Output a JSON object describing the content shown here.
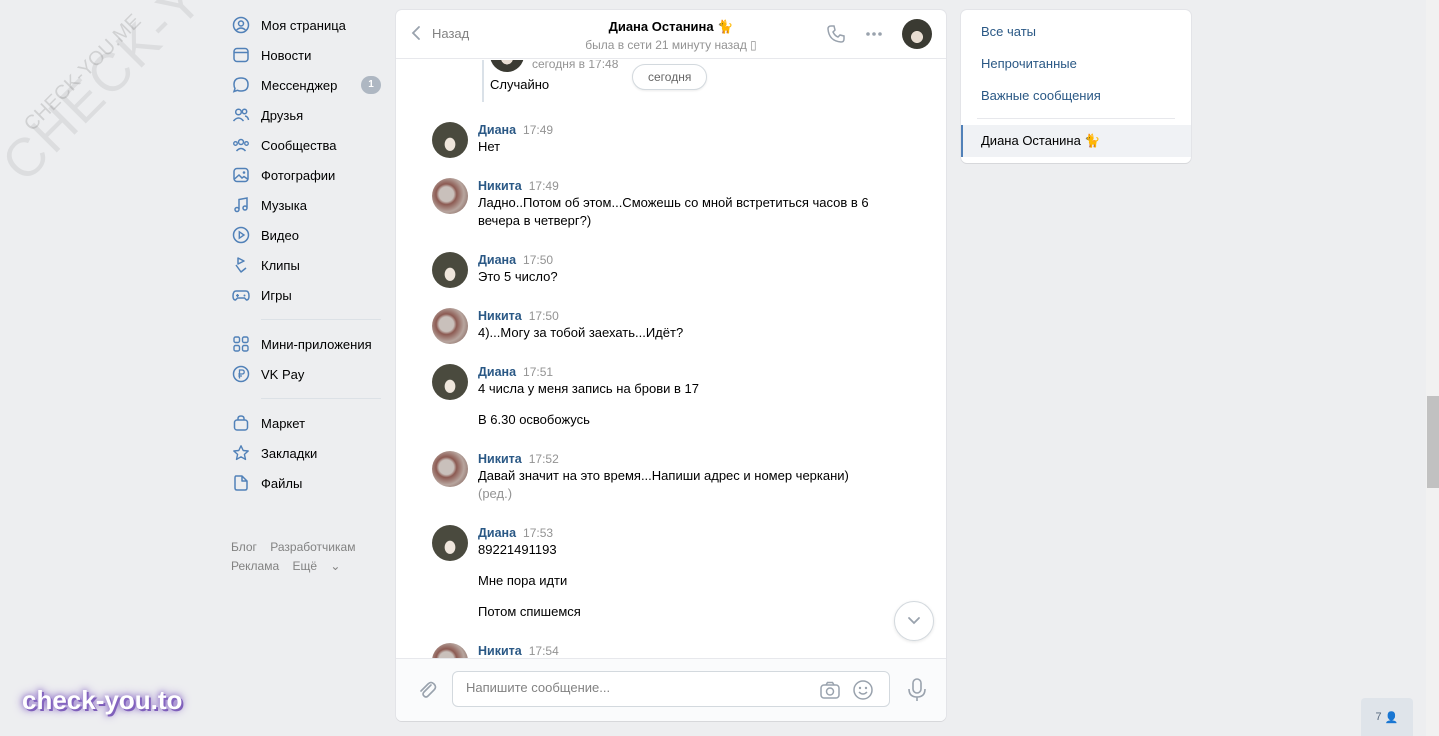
{
  "watermark": {
    "big": "CHECK-YOU.ME",
    "small": "CHECK-YOU.ME",
    "brand": "check-you.to"
  },
  "nav": {
    "items": [
      {
        "label": "Моя страница",
        "icon": "user-circle-icon"
      },
      {
        "label": "Новости",
        "icon": "news-icon"
      },
      {
        "label": "Мессенджер",
        "icon": "chat-bubble-icon",
        "badge": "1"
      },
      {
        "label": "Друзья",
        "icon": "friends-icon"
      },
      {
        "label": "Сообщества",
        "icon": "communities-icon"
      },
      {
        "label": "Фотографии",
        "icon": "photo-icon"
      },
      {
        "label": "Музыка",
        "icon": "music-note-icon"
      },
      {
        "label": "Видео",
        "icon": "play-circle-icon"
      },
      {
        "label": "Клипы",
        "icon": "clips-icon"
      },
      {
        "label": "Игры",
        "icon": "gamepad-icon"
      }
    ],
    "items2": [
      {
        "label": "Мини-приложения",
        "icon": "grid-apps-icon"
      },
      {
        "label": "VK Pay",
        "icon": "ruble-circle-icon"
      }
    ],
    "items3": [
      {
        "label": "Маркет",
        "icon": "shopping-bag-icon"
      },
      {
        "label": "Закладки",
        "icon": "star-icon"
      },
      {
        "label": "Файлы",
        "icon": "file-icon"
      }
    ],
    "footer": {
      "blog": "Блог",
      "dev": "Разработчикам",
      "ads": "Реклама",
      "more": "Ещё"
    }
  },
  "chat": {
    "back": "Назад",
    "peer_name": "Диана Останина 🐈",
    "peer_status": "была в сети 21 минуту назад",
    "quoted": {
      "time": "сегодня в 17:48",
      "text": "Случайно"
    },
    "date_pill": "сегодня",
    "messages": [
      {
        "author": "Диана",
        "time": "17:49",
        "lines": [
          "Нет"
        ]
      },
      {
        "author": "Никита",
        "time": "17:49",
        "lines": [
          "Ладно..Потом об этом...Сможешь со мной встретиться часов в 6 вечера в четверг?)"
        ]
      },
      {
        "author": "Диана",
        "time": "17:50",
        "lines": [
          "Это 5 число?"
        ]
      },
      {
        "author": "Никита",
        "time": "17:50",
        "lines": [
          "4)...Могу за тобой заехать...Идёт?"
        ]
      },
      {
        "author": "Диана",
        "time": "17:51",
        "lines": [
          "4 числа у меня запись на брови в 17",
          "В 6.30 освобожусь"
        ]
      },
      {
        "author": "Никита",
        "time": "17:52",
        "lines": [
          "Давай значит на это время...Напиши адрес и номер черкани)"
        ],
        "edited": "(ред.)"
      },
      {
        "author": "Диана",
        "time": "17:53",
        "lines": [
          "89221491193",
          "Мне пора идти",
          "Потом спишемся"
        ]
      },
      {
        "author": "Никита",
        "time": "17:54",
        "lines": []
      }
    ],
    "input_placeholder": "Напишите сообщение..."
  },
  "right": {
    "all_chats": "Все чаты",
    "unread": "Непрочитанные",
    "important": "Важные сообщения",
    "active_chat": "Диана Останина 🐈"
  },
  "online_count": "7"
}
